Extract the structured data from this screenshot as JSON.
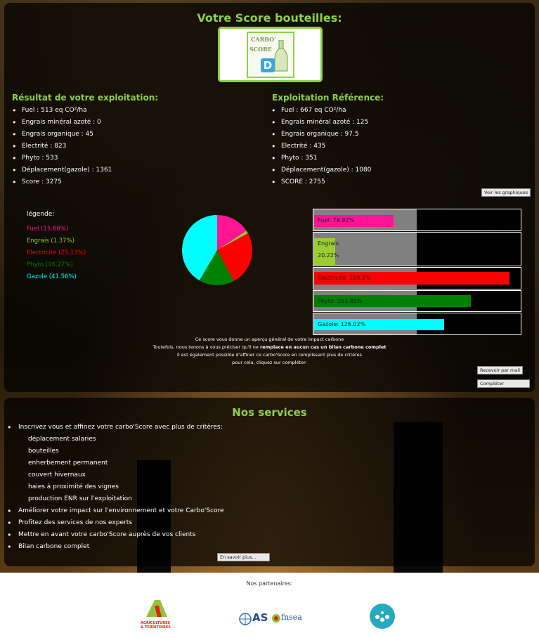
{
  "header": {
    "title": "Votre Score bouteilles:",
    "logo_line1": "CARBO'",
    "logo_line2": "SCORE",
    "grade": "D"
  },
  "own": {
    "title": "Résultat de votre exploitation:",
    "items": [
      "Fuel : 513 eq CO²/ha",
      "Engrais minéral azoté : 0",
      "Engrais organique : 45",
      "Electrité : 823",
      "Phyto : 533",
      "Déplacement(gazole) : 1361",
      "Score : 3275"
    ]
  },
  "ref": {
    "title": "Exploitation Référence:",
    "items": [
      "Fuel : 667 eq CO²/ha",
      "Engrais minéral azoté : 125",
      "Engrais organique : 97.5",
      "Electrité : 435",
      "Phyto : 351",
      "Déplacement(gazole) : 1080",
      "SCORE : 2755"
    ]
  },
  "buttons": {
    "charts": "Voir les graphiques",
    "mail": "Recevoir par mail",
    "complete": "Compléter",
    "more": "En savoir plus..."
  },
  "legend": {
    "title": "légende:",
    "items": [
      {
        "label": "Fuel (15.66%)",
        "color": "#ff1493"
      },
      {
        "label": "Engrais (1.37%)",
        "color": "#9acd32"
      },
      {
        "label": "Electricité (25.13%)",
        "color": "#ff0000"
      },
      {
        "label": "Phyto (16.27%)",
        "color": "#008000"
      },
      {
        "label": "Gazole (41.56%)",
        "color": "#00ffff"
      }
    ]
  },
  "chart_data": {
    "type": "pie",
    "categories": [
      "Fuel",
      "Engrais",
      "Electricité",
      "Phyto",
      "Gazole"
    ],
    "values": [
      15.66,
      1.37,
      25.13,
      16.27,
      41.56
    ],
    "colors": [
      "#ff1493",
      "#9acd32",
      "#ff0000",
      "#008000",
      "#00ffff"
    ]
  },
  "bars": [
    {
      "label1": "Fuel: 76.91%",
      "label2": "",
      "value": 76.91,
      "color": "#ff1493"
    },
    {
      "label1": "Engrais:",
      "label2": "20.22%",
      "value": 20.22,
      "color": "#9acd32"
    },
    {
      "label1": "Electricité: 189.2%",
      "label2": "",
      "value": 189.2,
      "color": "#ff0000"
    },
    {
      "label1": "Phyto: 151.85%",
      "label2": "",
      "value": 151.85,
      "color": "#008000"
    },
    {
      "label1": "Gazole: 126.02%",
      "label2": "",
      "value": 126.02,
      "color": "#00ffff"
    }
  ],
  "note": {
    "line1": "Ce score vous donne un aperçu général de votre impact carbone",
    "line2a": "Toutefois, nous tenons à vous préciser qu'il ne ",
    "line2b": "remplace en aucun cas un bilan carbone complet",
    "line3": "Il est également possible d'affiner ce carbo'Score en remplissant plus de critères",
    "line4": "pour cela, cliquez sur compléter:"
  },
  "services": {
    "title": "Nos services",
    "intro": "Inscrivez vous et affinez votre carbo'Score avec plus de critères:",
    "subitems": [
      "déplacement salaries",
      "bouteilles",
      "enherbement permanent",
      "couvert hivernaux",
      "haies à proximité des vignes",
      "production ENR sur l'exploitation"
    ],
    "items": [
      "Améliorer votre impact sur l'environnement et votre Carbo'Score",
      "Profitez des services de nos experts",
      "Mettre en avant votre carbo'Score auprès de vos clients",
      "Bilan carbone complet"
    ]
  },
  "footer": {
    "partners_label": "Nos partenaires:",
    "p1_line1": "AGRICULTURES",
    "p1_line2": "& TERRITOIRES",
    "p2": "AS",
    "p2b": "fnsea"
  }
}
